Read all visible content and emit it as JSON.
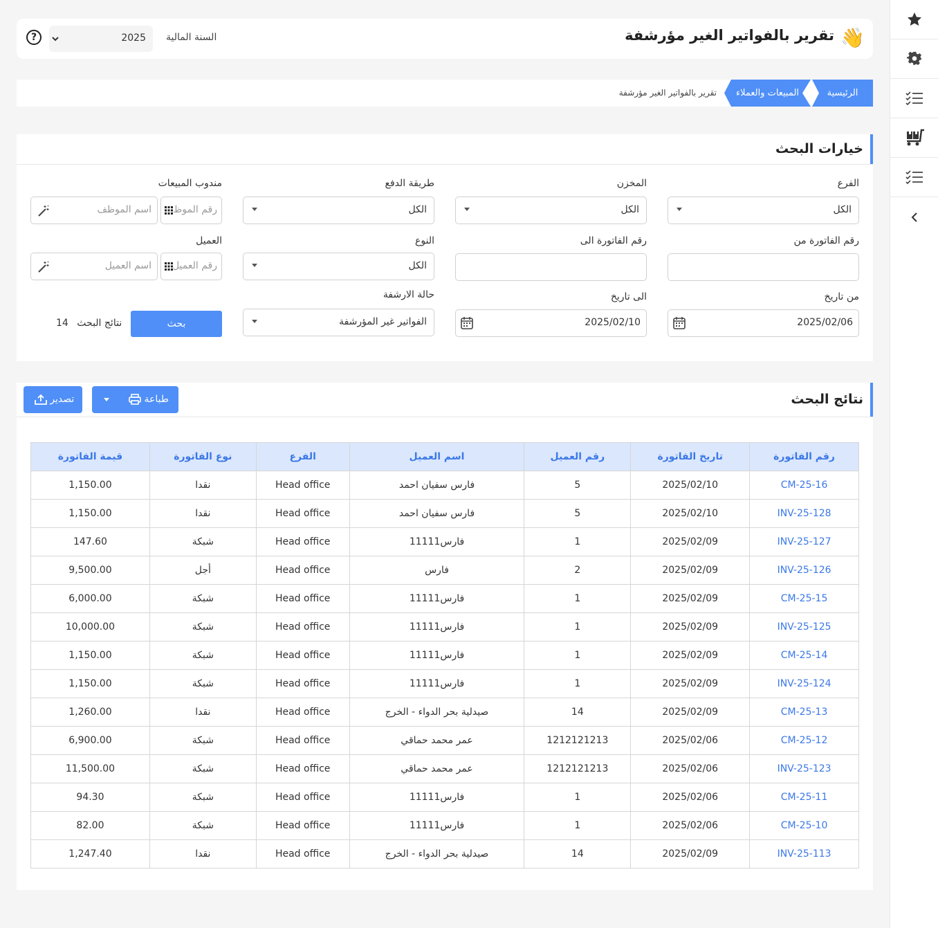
{
  "header": {
    "title": "تقرير بالفواتير الغير مؤرشفة",
    "wave_emoji": "👋",
    "fiscal_year_label": "السنة المالية",
    "fiscal_year_value": "2025",
    "help_glyph": "?"
  },
  "breadcrumb": {
    "home": "الرئيسية",
    "section": "المبيعات والعملاء",
    "current": "تقرير بالفواتير الغير مؤرشفة"
  },
  "search": {
    "title": "خيارات البحث",
    "branch_label": "الفرع",
    "branch_value": "الكل",
    "warehouse_label": "المخزن",
    "warehouse_value": "الكل",
    "payment_label": "طريقة الدفع",
    "payment_value": "الكل",
    "sales_rep_label": "مندوب المبيعات",
    "sales_rep_num_placeholder": "رقم الموظف",
    "sales_rep_name_placeholder": "اسم الموظف",
    "invoice_from_label": "رقم الفاتورة من",
    "invoice_from_value": "",
    "invoice_to_label": "رقم الفاتورة الى",
    "invoice_to_value": "",
    "type_label": "النوع",
    "type_value": "الكل",
    "customer_label": "العميل",
    "customer_num_placeholder": "رقم العميل",
    "customer_name_placeholder": "اسم العميل",
    "date_from_label": "من تاريخ",
    "date_from_value": "2025/02/06",
    "date_to_label": "الى تاريخ",
    "date_to_value": "2025/02/10",
    "archive_status_label": "حالة الارشفة",
    "archive_status_value": "الفواتير غير المؤرشفة",
    "search_button": "بحث",
    "results_count_label": "نتائج البحث",
    "results_count_value": "14"
  },
  "results": {
    "title": "نتائج البحث",
    "print_button": "طباعة",
    "export_button": "تصدير",
    "columns": [
      "رقم الفاتورة",
      "تاريخ الفاتورة",
      "رقم العميل",
      "اسم العميل",
      "الفرع",
      "نوع الفاتورة",
      "قيمة الفاتورة"
    ],
    "rows": [
      [
        "CM-25-16",
        "2025/02/10",
        "5",
        "فارس سفيان احمد",
        "Head office",
        "نقدا",
        "1,150.00"
      ],
      [
        "INV-25-128",
        "2025/02/10",
        "5",
        "فارس سفيان احمد",
        "Head office",
        "نقدا",
        "1,150.00"
      ],
      [
        "INV-25-127",
        "2025/02/09",
        "1",
        "فارس11111",
        "Head office",
        "شبكة",
        "147.60"
      ],
      [
        "INV-25-126",
        "2025/02/09",
        "2",
        "فارس",
        "Head office",
        "أجل",
        "9,500.00"
      ],
      [
        "CM-25-15",
        "2025/02/09",
        "1",
        "فارس11111",
        "Head office",
        "شبكة",
        "6,000.00"
      ],
      [
        "INV-25-125",
        "2025/02/09",
        "1",
        "فارس11111",
        "Head office",
        "شبكة",
        "10,000.00"
      ],
      [
        "CM-25-14",
        "2025/02/09",
        "1",
        "فارس11111",
        "Head office",
        "شبكة",
        "1,150.00"
      ],
      [
        "INV-25-124",
        "2025/02/09",
        "1",
        "فارس11111",
        "Head office",
        "شبكة",
        "1,150.00"
      ],
      [
        "CM-25-13",
        "2025/02/09",
        "14",
        "صيدلية بحر الدواء - الخرج",
        "Head office",
        "نقدا",
        "1,260.00"
      ],
      [
        "CM-25-12",
        "2025/02/06",
        "1212121213",
        "عمر محمد حماقي",
        "Head office",
        "شبكة",
        "6,900.00"
      ],
      [
        "INV-25-123",
        "2025/02/06",
        "1212121213",
        "عمر محمد حماقي",
        "Head office",
        "شبكة",
        "11,500.00"
      ],
      [
        "CM-25-11",
        "2025/02/06",
        "1",
        "فارس11111",
        "Head office",
        "شبكة",
        "94.30"
      ],
      [
        "CM-25-10",
        "2025/02/06",
        "1",
        "فارس11111",
        "Head office",
        "شبكة",
        "82.00"
      ],
      [
        "INV-25-113",
        "2025/02/09",
        "14",
        "صيدلية بحر الدواء - الخرج",
        "Head office",
        "نقدا",
        "1,247.40"
      ]
    ]
  },
  "rail": {
    "icons": [
      "star-icon",
      "gear-icon",
      "checklist-icon",
      "cart-icon",
      "checklist-icon",
      "chevron-left-icon"
    ]
  },
  "colors": {
    "accent": "#4f8ff7",
    "link": "#3b78e7",
    "table_header_bg": "#dbe7fc"
  }
}
